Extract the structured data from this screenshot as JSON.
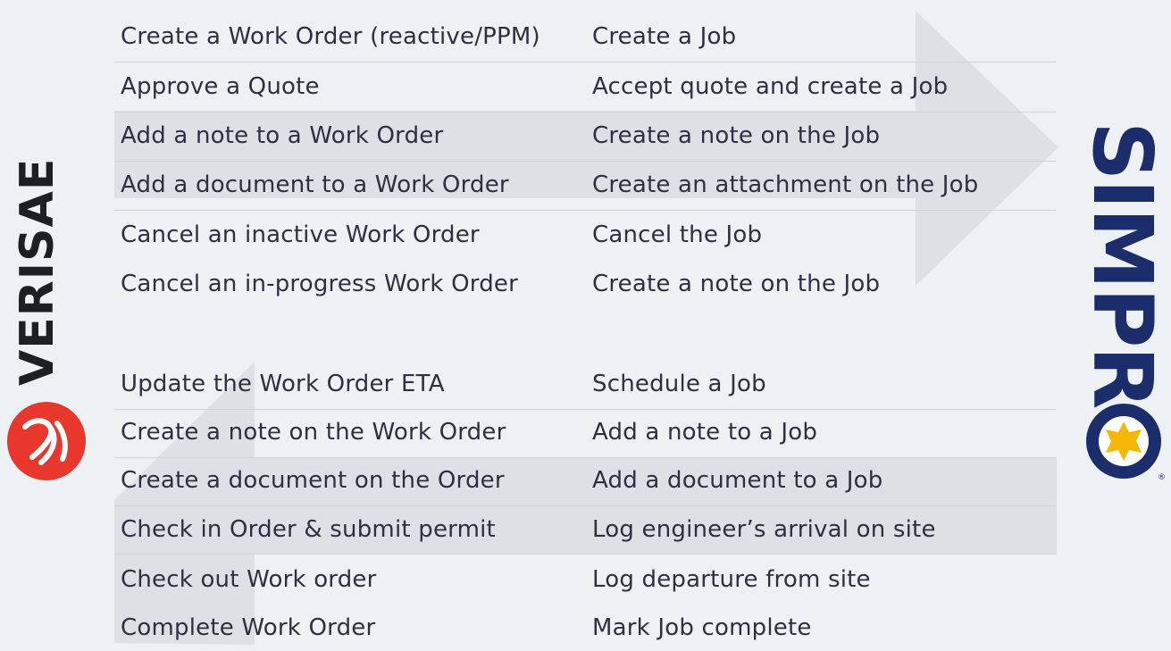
{
  "verisae": {
    "brand": "VERISAE",
    "icon": "verisae-v-icon",
    "color": "#e8372c"
  },
  "simpro": {
    "brand": "SIMPR",
    "icon": "simpro-sun-icon",
    "registered": "®",
    "color": "#1b2d6b",
    "accent": "#f5b800"
  },
  "to_simpro": [
    {
      "verisae": "Create a Work Order (reactive/PPM)",
      "simpro": "Create a Job"
    },
    {
      "verisae": "Approve a Quote",
      "simpro": "Accept quote and create a Job"
    },
    {
      "verisae": "Add a note to a Work Order",
      "simpro": "Create a note on the Job"
    },
    {
      "verisae": "Add a document to a Work Order",
      "simpro": "Create an attachment on the Job"
    },
    {
      "verisae": "Cancel an inactive Work Order",
      "simpro": "Cancel the Job"
    },
    {
      "verisae": "Cancel an in-progress Work Order",
      "simpro": "Create a note on the Job"
    }
  ],
  "to_verisae": [
    {
      "verisae": "Update the Work Order ETA",
      "simpro": "Schedule a Job"
    },
    {
      "verisae": "Create a note on the Work Order",
      "simpro": "Add a note to a Job"
    },
    {
      "verisae": "Create a document on the Order",
      "simpro": "Add a document to a Job"
    },
    {
      "verisae": "Check in Order & submit permit",
      "simpro": "Log engineer’s arrival on site"
    },
    {
      "verisae": "Check out Work order",
      "simpro": "Log departure from site"
    },
    {
      "verisae": "Complete Work Order",
      "simpro": "Mark Job complete"
    }
  ]
}
